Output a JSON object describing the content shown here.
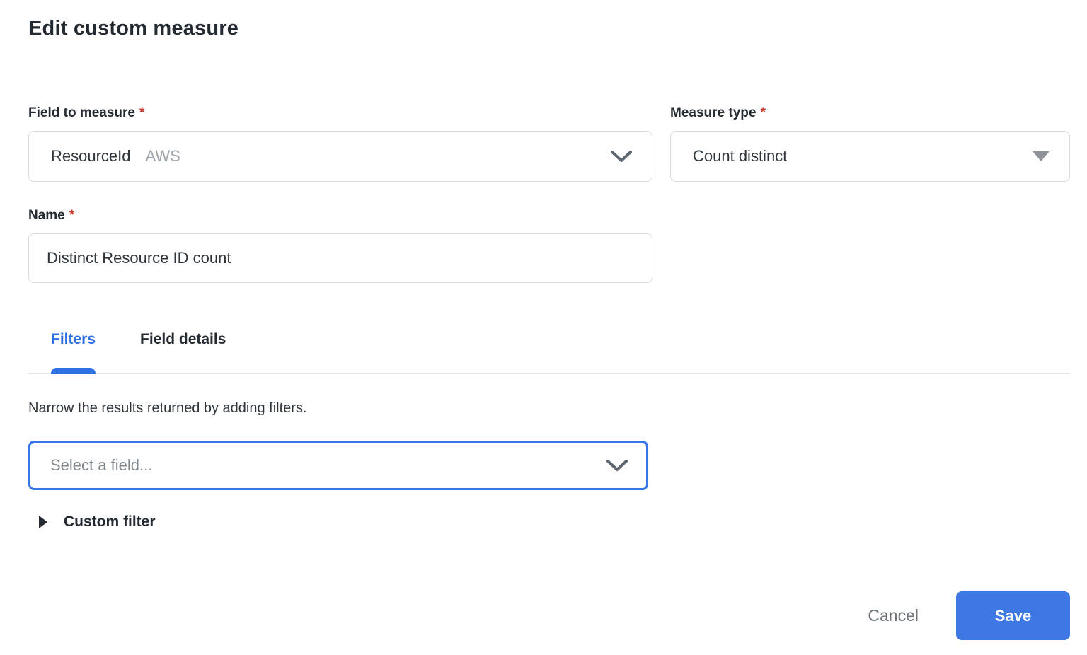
{
  "page_title": "Edit custom measure",
  "required_marker": "*",
  "fields": {
    "field_to_measure": {
      "label": "Field to measure",
      "value": "ResourceId",
      "value_tag": "AWS"
    },
    "measure_type": {
      "label": "Measure type",
      "value": "Count distinct"
    },
    "name": {
      "label": "Name",
      "value": "Distinct Resource ID count"
    }
  },
  "tabs": [
    {
      "label": "Filters"
    },
    {
      "label": "Field details"
    }
  ],
  "filters_panel": {
    "description": "Narrow the results returned by adding filters.",
    "field_select_placeholder": "Select a field...",
    "custom_filter_label": "Custom filter"
  },
  "footer": {
    "cancel_label": "Cancel",
    "save_label": "Save"
  },
  "colors": {
    "accent_blue": "#3D78E4",
    "tab_active_blue": "#2E70E3",
    "focus_border_blue": "#3775E8",
    "required_red": "#C53829",
    "input_border_gray": "#D9DBDE"
  }
}
